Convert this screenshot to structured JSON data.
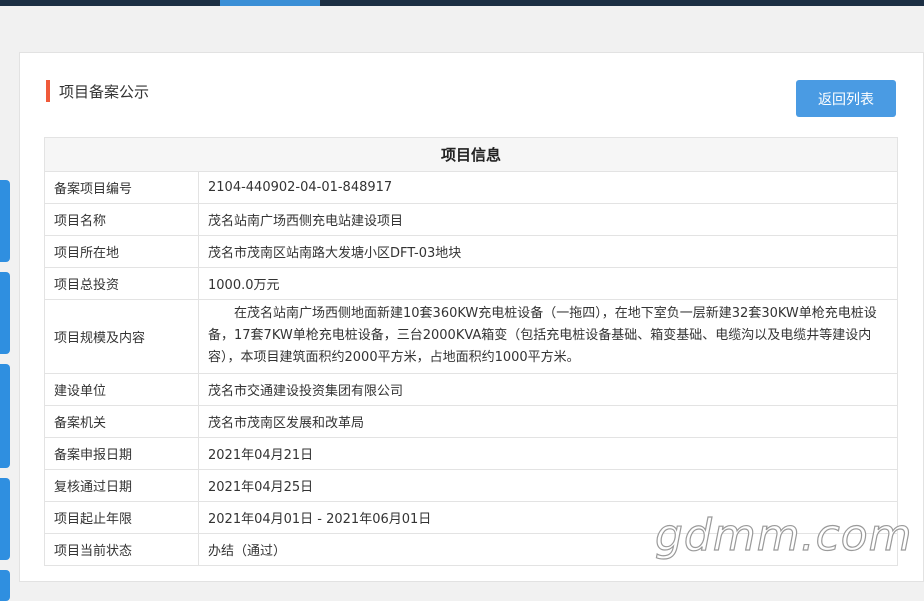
{
  "header": {
    "title": "项目备案公示",
    "back_label": "返回列表"
  },
  "table": {
    "heading": "项目信息",
    "rows": [
      {
        "label": "备案项目编号",
        "value": "2104-440902-04-01-848917"
      },
      {
        "label": "项目名称",
        "value": "茂名站南广场西侧充电站建设项目"
      },
      {
        "label": "项目所在地",
        "value": "茂名市茂南区站南路大发塘小区DFT-03地块"
      },
      {
        "label": "项目总投资",
        "value": "1000.0万元"
      },
      {
        "label": "项目规模及内容",
        "value": "在茂名站南广场西侧地面新建10套360KW充电桩设备（一拖四），在地下室负一层新建32套30KW单枪充电桩设备，17套7KW单枪充电桩设备，三台2000KVA箱变（包括充电桩设备基础、箱变基础、电缆沟以及电缆井等建设内容），本项目建筑面积约2000平方米，占地面积约1000平方米。"
      },
      {
        "label": "建设单位",
        "value": "茂名市交通建设投资集团有限公司"
      },
      {
        "label": "备案机关",
        "value": "茂名市茂南区发展和改革局"
      },
      {
        "label": "备案申报日期",
        "value": "2021年04月21日"
      },
      {
        "label": "复核通过日期",
        "value": "2021年04月25日"
      },
      {
        "label": "项目起止年限",
        "value": "2021年04月01日 - 2021年06月01日"
      },
      {
        "label": "项目当前状态",
        "value": "办结（通过）"
      }
    ]
  },
  "watermark": "gdmm.com",
  "colors": {
    "accent": "#f05a3a",
    "button": "#4a9be3",
    "topbar": "#1c2f44",
    "side_tab": "#2f8fe0"
  }
}
